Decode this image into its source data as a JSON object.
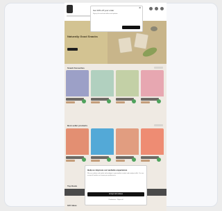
{
  "hero": {
    "title": "Naturally Good Snacks"
  },
  "popup": {
    "title": "Get 10% off your order",
    "body": "Sign up for exclusive offers and updates",
    "close": "×"
  },
  "sections": [
    {
      "title": "Snack Favourites"
    },
    {
      "title": "Best-seller products"
    },
    {
      "title": "Top Deals"
    },
    {
      "title": "Gift Ideas"
    }
  ],
  "cookie": {
    "title": "Help us improve our website experience",
    "body": "We use cookies and similar technologies to personalise content and analyse traffic. You can accept all cookies or choose your preferences.",
    "accept": "Accept all cookies",
    "links": "Preferences · Reject all"
  },
  "colors": {
    "page_bg": "#efeae3",
    "cart": "#4fa35d",
    "dark": "#111111"
  }
}
